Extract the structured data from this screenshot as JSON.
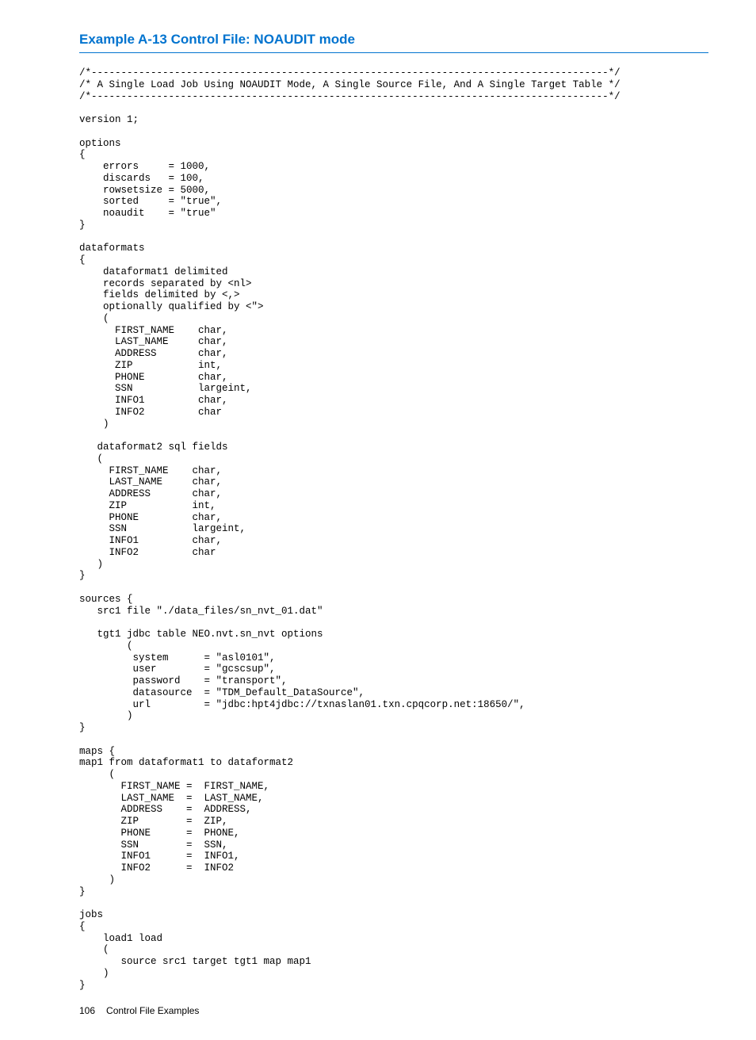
{
  "heading": "Example A-13 Control File: NOAUDIT mode",
  "code": "/*---------------------------------------------------------------------------------------*/\n/* A Single Load Job Using NOAUDIT Mode, A Single Source File, And A Single Target Table */\n/*---------------------------------------------------------------------------------------*/\n\nversion 1;\n\noptions\n{\n    errors     = 1000,\n    discards   = 100,\n    rowsetsize = 5000,\n    sorted     = \"true\",\n    noaudit    = \"true\"\n}\n\ndataformats\n{\n    dataformat1 delimited\n    records separated by <nl>\n    fields delimited by <,>\n    optionally qualified by <\">\n    (\n      FIRST_NAME    char,\n      LAST_NAME     char,\n      ADDRESS       char,\n      ZIP           int,\n      PHONE         char,\n      SSN           largeint,\n      INFO1         char,\n      INFO2         char\n    )\n\n   dataformat2 sql fields\n   (\n     FIRST_NAME    char,\n     LAST_NAME     char,\n     ADDRESS       char,\n     ZIP           int,\n     PHONE         char,\n     SSN           largeint,\n     INFO1         char,\n     INFO2         char\n   )\n}\n\nsources {\n   src1 file \"./data_files/sn_nvt_01.dat\"\n\n   tgt1 jdbc table NEO.nvt.sn_nvt options\n        (\n         system      = \"asl0101\",\n         user        = \"gcscsup\",\n         password    = \"transport\",\n         datasource  = \"TDM_Default_DataSource\",\n         url         = \"jdbc:hpt4jdbc://txnaslan01.txn.cpqcorp.net:18650/\",\n        )\n}\n\nmaps {\nmap1 from dataformat1 to dataformat2\n     (\n       FIRST_NAME =  FIRST_NAME,\n       LAST_NAME  =  LAST_NAME,\n       ADDRESS    =  ADDRESS,\n       ZIP        =  ZIP,\n       PHONE      =  PHONE,\n       SSN        =  SSN,\n       INFO1      =  INFO1,\n       INFO2      =  INFO2\n     )\n}\n\njobs\n{\n    load1 load\n    (\n       source src1 target tgt1 map map1\n    )\n}",
  "footer": {
    "page_number": "106",
    "section_title": "Control File Examples"
  }
}
